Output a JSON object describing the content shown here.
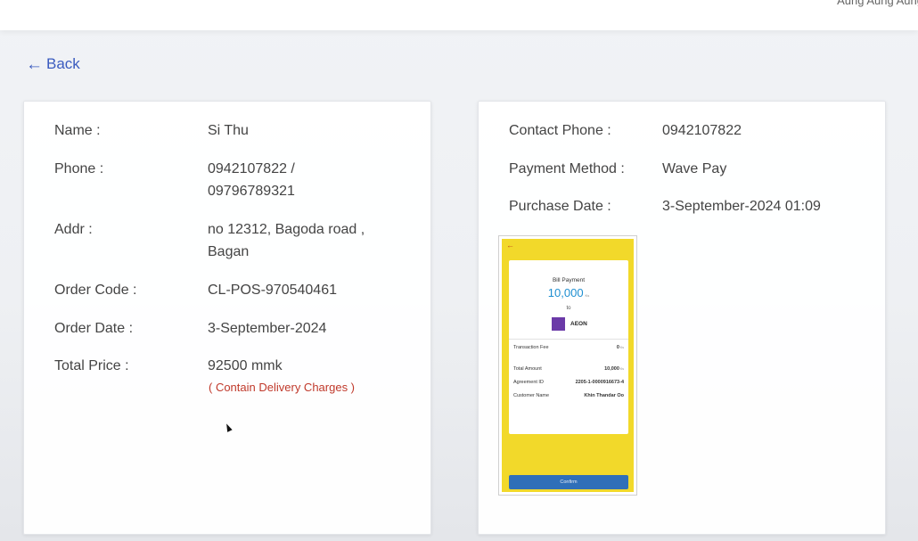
{
  "header": {
    "user_name": "Aung Aung Aung"
  },
  "nav": {
    "back_label": "Back"
  },
  "customer": {
    "name_label": "Name :",
    "name": "Si Thu",
    "phone_label": "Phone :",
    "phone_1": "0942107822 /",
    "phone_2": "09796789321",
    "addr_label": "Addr :",
    "addr_1": "no 12312, Bagoda road ,",
    "addr_2": "Bagan",
    "order_code_label": "Order Code :",
    "order_code": "CL-POS-970540461",
    "order_date_label": "Order Date :",
    "order_date": "3-September-2024",
    "total_price_label": "Total Price :",
    "total_price": "92500 mmk",
    "delivery_note": "( Contain Delivery Charges )"
  },
  "payment": {
    "contact_phone_label": "Contact Phone :",
    "contact_phone": "0942107822",
    "method_label": "Payment Method :",
    "method": "Wave Pay",
    "purchase_date_label": "Purchase Date :",
    "purchase_date": "3-September-2024 01:09"
  },
  "receipt": {
    "title": "Bill Payment",
    "amount": "10,000",
    "currency": "Ks",
    "to": "to",
    "merchant": "AEON",
    "rows": [
      {
        "label": "Transaction Fee",
        "value": "0"
      },
      {
        "label": "Total Amount",
        "value": "10,000"
      },
      {
        "label": "Agreement ID",
        "value": "2205-1-0000916673-4"
      },
      {
        "label": "Customer Name",
        "value": "Khin Thandar Oo"
      }
    ],
    "confirm_label": "Confirm"
  },
  "colors": {
    "link": "#3a5bbf",
    "note": "#c0392b",
    "receipt_bg": "#f2d92a",
    "confirm": "#2f6fb8",
    "amount": "#1e8fd1"
  }
}
